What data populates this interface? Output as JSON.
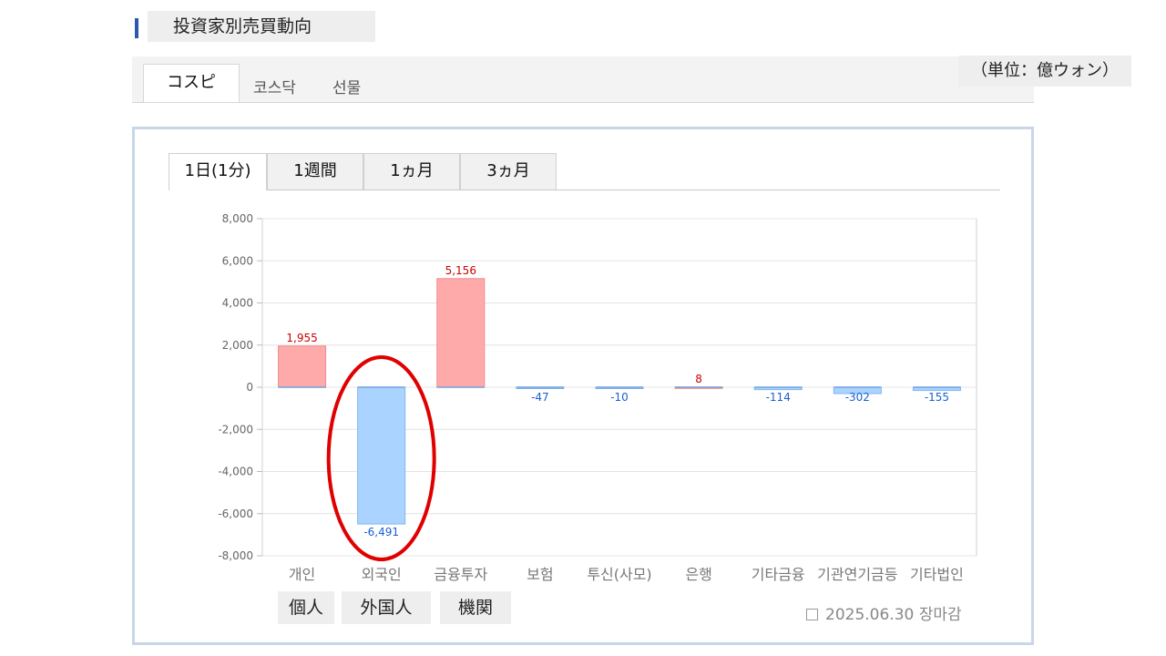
{
  "section": {
    "title": "投資家別売買動向"
  },
  "market_tabs": [
    {
      "label": "コスピ",
      "active": true
    },
    {
      "label": "코스닥",
      "active": false
    },
    {
      "label": "선물",
      "active": false
    }
  ],
  "unit_label": "（単位：億ウォン）",
  "period_tabs": [
    {
      "label": "1日(1分)",
      "active": true
    },
    {
      "label": "1週間",
      "active": false
    },
    {
      "label": "1ヵ月",
      "active": false
    },
    {
      "label": "3ヵ月",
      "active": false
    }
  ],
  "investor_labels": [
    "個人",
    "外国人",
    "機関"
  ],
  "footnote": {
    "date": "2025.06.30",
    "status": "장마감"
  },
  "colors": {
    "positive_fill": "#ffaaaa",
    "negative_fill": "#aad4ff",
    "positive_text": "#cc0000",
    "negative_text": "#1a5fd0",
    "highlight": "#e00000"
  },
  "chart_data": {
    "type": "bar",
    "categories": [
      "개인",
      "외국인",
      "금융투자",
      "보험",
      "투신(사모)",
      "은행",
      "기타금융",
      "기관연기금등",
      "기타법인"
    ],
    "values": [
      1955,
      -6491,
      5156,
      -47,
      -10,
      8,
      -114,
      -302,
      -155
    ],
    "data_labels": [
      "1,955",
      "-6,491",
      "5,156",
      "-47",
      "-10",
      "8",
      "-114",
      "-302",
      "-155"
    ],
    "yticks": [
      "8,000",
      "6,000",
      "4,000",
      "2,000",
      "0",
      "-2,000",
      "-4,000",
      "-6,000",
      "-8,000"
    ],
    "ylim": [
      -8000,
      8000
    ],
    "grid": true,
    "highlight_category": "외국인"
  }
}
